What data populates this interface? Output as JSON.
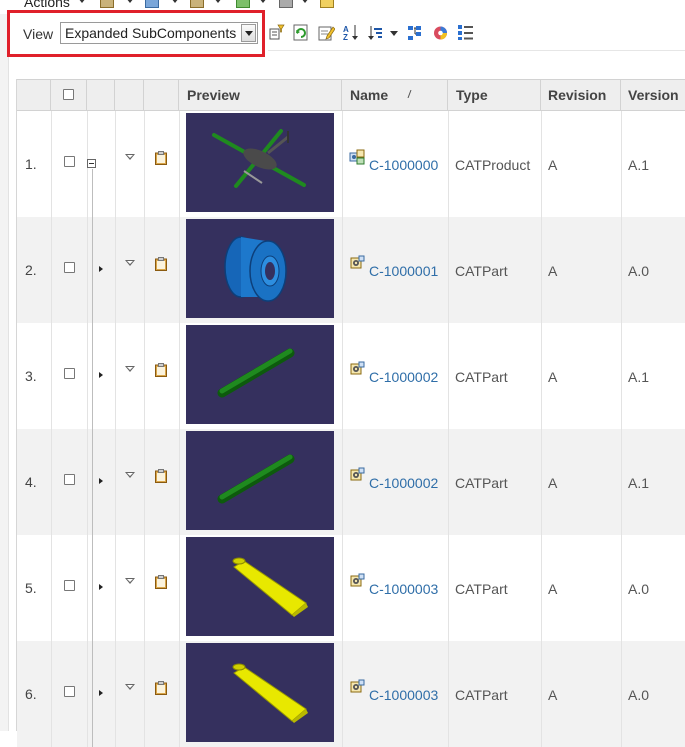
{
  "toolbar": {
    "actions_label": "Actions",
    "view_label": "View",
    "view_value": "Expanded SubComponents"
  },
  "table": {
    "columns": [
      "Preview",
      "Name",
      "Type",
      "Revision",
      "Version"
    ],
    "rows": [
      {
        "num": "1.",
        "name": "C-1000000",
        "type": "CATProduct",
        "revision": "A",
        "version": "A.1",
        "preview": "helicopter"
      },
      {
        "num": "2.",
        "name": "C-1000001",
        "type": "CATPart",
        "revision": "A",
        "version": "A.0",
        "preview": "spool"
      },
      {
        "num": "3.",
        "name": "C-1000002",
        "type": "CATPart",
        "revision": "A",
        "version": "A.1",
        "preview": "rod"
      },
      {
        "num": "4.",
        "name": "C-1000002",
        "type": "CATPart",
        "revision": "A",
        "version": "A.1",
        "preview": "rod"
      },
      {
        "num": "5.",
        "name": "C-1000003",
        "type": "CATPart",
        "revision": "A",
        "version": "A.0",
        "preview": "blade"
      },
      {
        "num": "6.",
        "name": "C-1000003",
        "type": "CATPart",
        "revision": "A",
        "version": "A.0",
        "preview": "blade"
      }
    ]
  },
  "colors": {
    "highlight_border": "#e0202a",
    "link": "#2f6ea8",
    "preview_bg": "#35305e"
  }
}
